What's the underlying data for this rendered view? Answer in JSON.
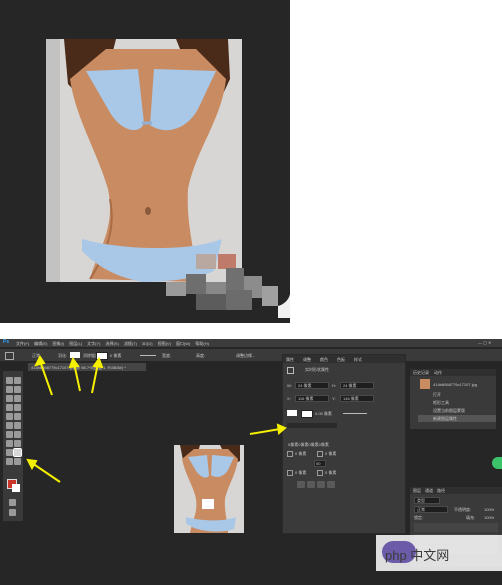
{
  "app": {
    "logo": "Ps",
    "menu": [
      "文件(F)",
      "编辑(E)",
      "图像(I)",
      "图层(L)",
      "文字(Y)",
      "选择(S)",
      "滤镜(T)",
      "3D(D)",
      "视图(V)",
      "窗口(W)",
      "帮助(H)"
    ],
    "options_bar": {
      "feather_label": "羽化:",
      "feather_value": "0 像素",
      "mode_label": "消除锯齿",
      "style_label": "样式:",
      "style_value": "正常",
      "width_label": "宽度:",
      "height_label": "高度:",
      "refine_button": "调整边缘..."
    },
    "document_tab": "414b6068779c17107.jpg @ 66.7%(图层 1, RGB/8#) *",
    "properties_panel": {
      "tabs": [
        "属性",
        "调整",
        "颜色",
        "色板",
        "样式"
      ],
      "title": "实时形状属性",
      "w_label": "W:",
      "w_value": "24 像素",
      "h_label": "H:",
      "h_value": "24 像素",
      "x_label": "X:",
      "x_value": "116 像素",
      "y_label": "Y:",
      "y_value": "146 像素",
      "stroke_value": "0.05 像素",
      "corner_value": "0像素0像素0像素0像素",
      "corners": [
        "0 像素",
        "0 像素",
        "0 像素",
        "0 像素"
      ],
      "link_value": "00"
    },
    "history_panel": {
      "tabs": [
        "历史记录",
        "动作"
      ],
      "snapshot_label": "414b6068779c17107.jpg",
      "items": [
        "打开",
        "矩形工具",
        "设置当前图层蒙版",
        "新建图层属性"
      ]
    },
    "layers_panel": {
      "tabs": [
        "图层",
        "通道",
        "路径"
      ],
      "kind_label": "类型",
      "blend_mode": "正常",
      "opacity_label": "不透明度:",
      "opacity_value": "100%",
      "lock_label": "锁定:",
      "fill_label": "填充:",
      "fill_value": "100%"
    },
    "watermark": "php 中文网"
  },
  "colors": {
    "ps_bg": "#262626",
    "ps_panel": "#3a3a3a",
    "ps_bar": "#3c3c3c",
    "arrow": "#f5f000",
    "fg_color": "#c8352a",
    "php_purple": "#6b5ba8",
    "green_badge": "#3cc46a"
  }
}
